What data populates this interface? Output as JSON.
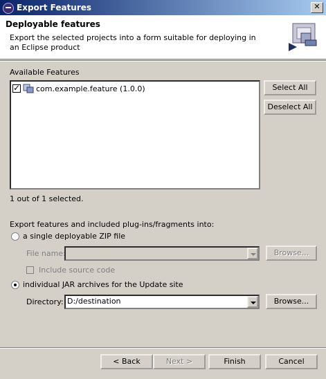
{
  "window": {
    "title": "Export Features"
  },
  "header": {
    "title": "Deployable features",
    "description": "Export the selected projects into a form suitable for deploying in an Eclipse product"
  },
  "features": {
    "label": "Available Features",
    "items": [
      {
        "label": "com.example.feature (1.0.0)",
        "checked": true
      }
    ],
    "select_all_label": "Select All",
    "deselect_all_label": "Deselect All",
    "selection_status": "1 out of 1 selected."
  },
  "export": {
    "label": "Export features and included plug-ins/fragments into:",
    "zip_option": {
      "label": "a single deployable ZIP file",
      "selected": false,
      "file_name_label": "File name:",
      "file_name_value": "",
      "browse_label": "Browse...",
      "include_source_label": "Include source code"
    },
    "jar_option": {
      "label": "individual JAR archives for the Update site",
      "selected": true,
      "directory_label": "Directory:",
      "directory_value": "D:/destination",
      "browse_label": "Browse..."
    }
  },
  "buttons": {
    "back": "< Back",
    "next": "Next >",
    "finish": "Finish",
    "cancel": "Cancel"
  },
  "colors": {
    "title_bar": "#0a246a",
    "dialog_bg": "#d4d0c8"
  }
}
